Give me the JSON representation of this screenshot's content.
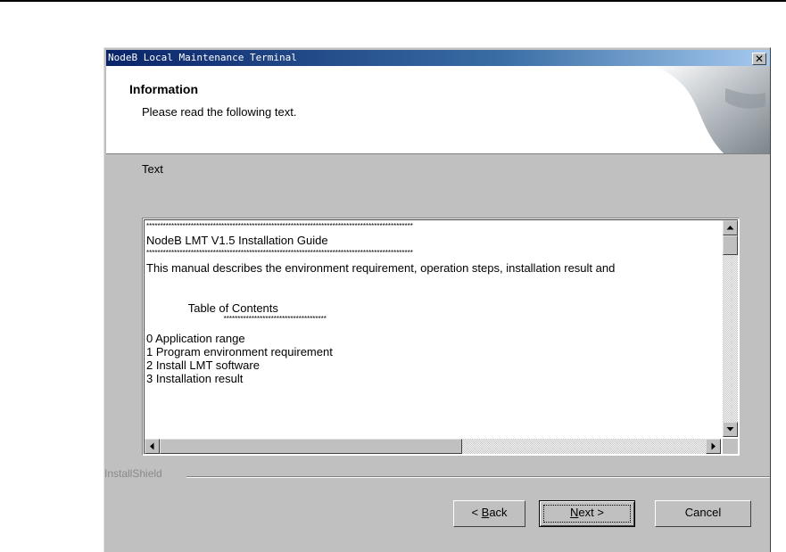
{
  "window": {
    "title": "NodeB Local Maintenance Terminal",
    "close_glyph": "✕"
  },
  "header": {
    "title": "Information",
    "subtitle": "Please read the following text."
  },
  "section_label": "Text",
  "text_content": {
    "lines": [
      {
        "kind": "stars",
        "text": "************************************************************************************************"
      },
      {
        "kind": "text",
        "text": "NodeB LMT V1.5 Installation Guide"
      },
      {
        "kind": "stars",
        "text": "************************************************************************************************"
      },
      {
        "kind": "text",
        "text": "This manual describes the environment requirement, operation steps, installation result and"
      },
      {
        "kind": "blank",
        "text": ""
      },
      {
        "kind": "blank",
        "text": ""
      },
      {
        "kind": "text",
        "text": "             Table of Contents"
      },
      {
        "kind": "stars",
        "text": "                                       *************************************"
      },
      {
        "kind": "text",
        "text": "0  Application range"
      },
      {
        "kind": "text",
        "text": "1  Program environment requirement"
      },
      {
        "kind": "text",
        "text": "2  Install LMT software"
      },
      {
        "kind": "text",
        "text": "3  Installation result"
      }
    ]
  },
  "footer": {
    "brand": "InstallShield"
  },
  "buttons": {
    "back": {
      "prefix": "< ",
      "mnemonic": "B",
      "rest": "ack"
    },
    "next": {
      "mnemonic": "N",
      "rest": "ext >"
    },
    "cancel": "Cancel"
  },
  "icons": {
    "close": "close-icon",
    "scroll_up": "arrow-up-icon",
    "scroll_down": "arrow-down-icon",
    "scroll_left": "arrow-left-icon",
    "scroll_right": "arrow-right-icon"
  },
  "colors": {
    "titlebar_start": "#0a246a",
    "titlebar_end": "#a6caf0",
    "dialog_face": "#c0c0c0"
  }
}
